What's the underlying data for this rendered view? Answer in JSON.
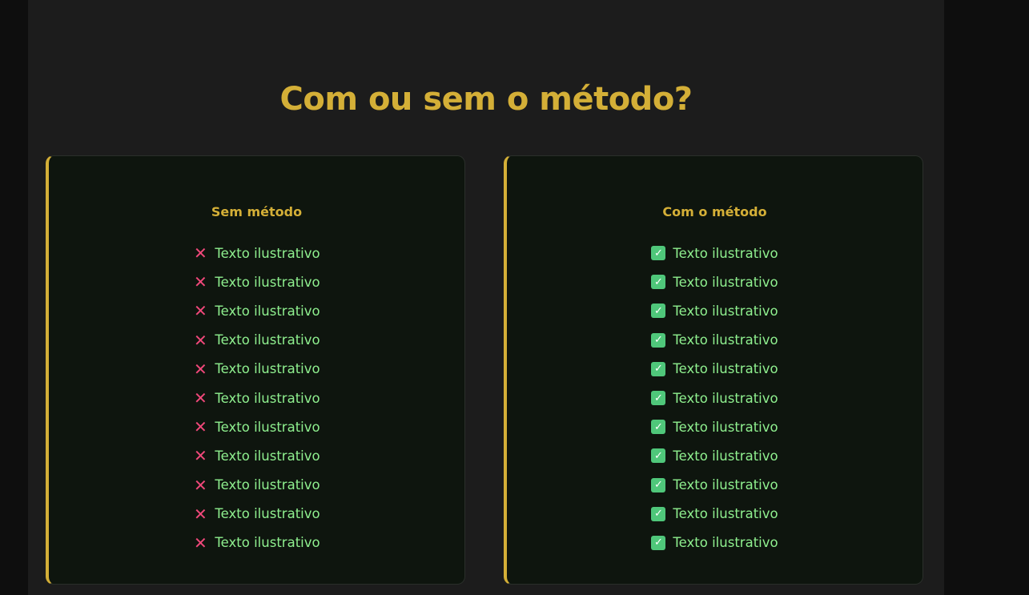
{
  "title": "Com ou sem o método?",
  "colors": {
    "accent": "#d4af37",
    "text": "#8ff08f",
    "cross": "#f0487a",
    "check": "#4fc77a"
  },
  "cards": [
    {
      "heading": "Sem método",
      "icon": "cross-icon",
      "items": [
        "Texto ilustrativo",
        "Texto ilustrativo",
        "Texto ilustrativo",
        "Texto ilustrativo",
        "Texto ilustrativo",
        "Texto ilustrativo",
        "Texto ilustrativo",
        "Texto ilustrativo",
        "Texto ilustrativo",
        "Texto ilustrativo",
        "Texto ilustrativo"
      ]
    },
    {
      "heading": "Com o método",
      "icon": "check-icon",
      "items": [
        "Texto ilustrativo",
        "Texto ilustrativo",
        "Texto ilustrativo",
        "Texto ilustrativo",
        "Texto ilustrativo",
        "Texto ilustrativo",
        "Texto ilustrativo",
        "Texto ilustrativo",
        "Texto ilustrativo",
        "Texto ilustrativo",
        "Texto ilustrativo"
      ]
    }
  ]
}
